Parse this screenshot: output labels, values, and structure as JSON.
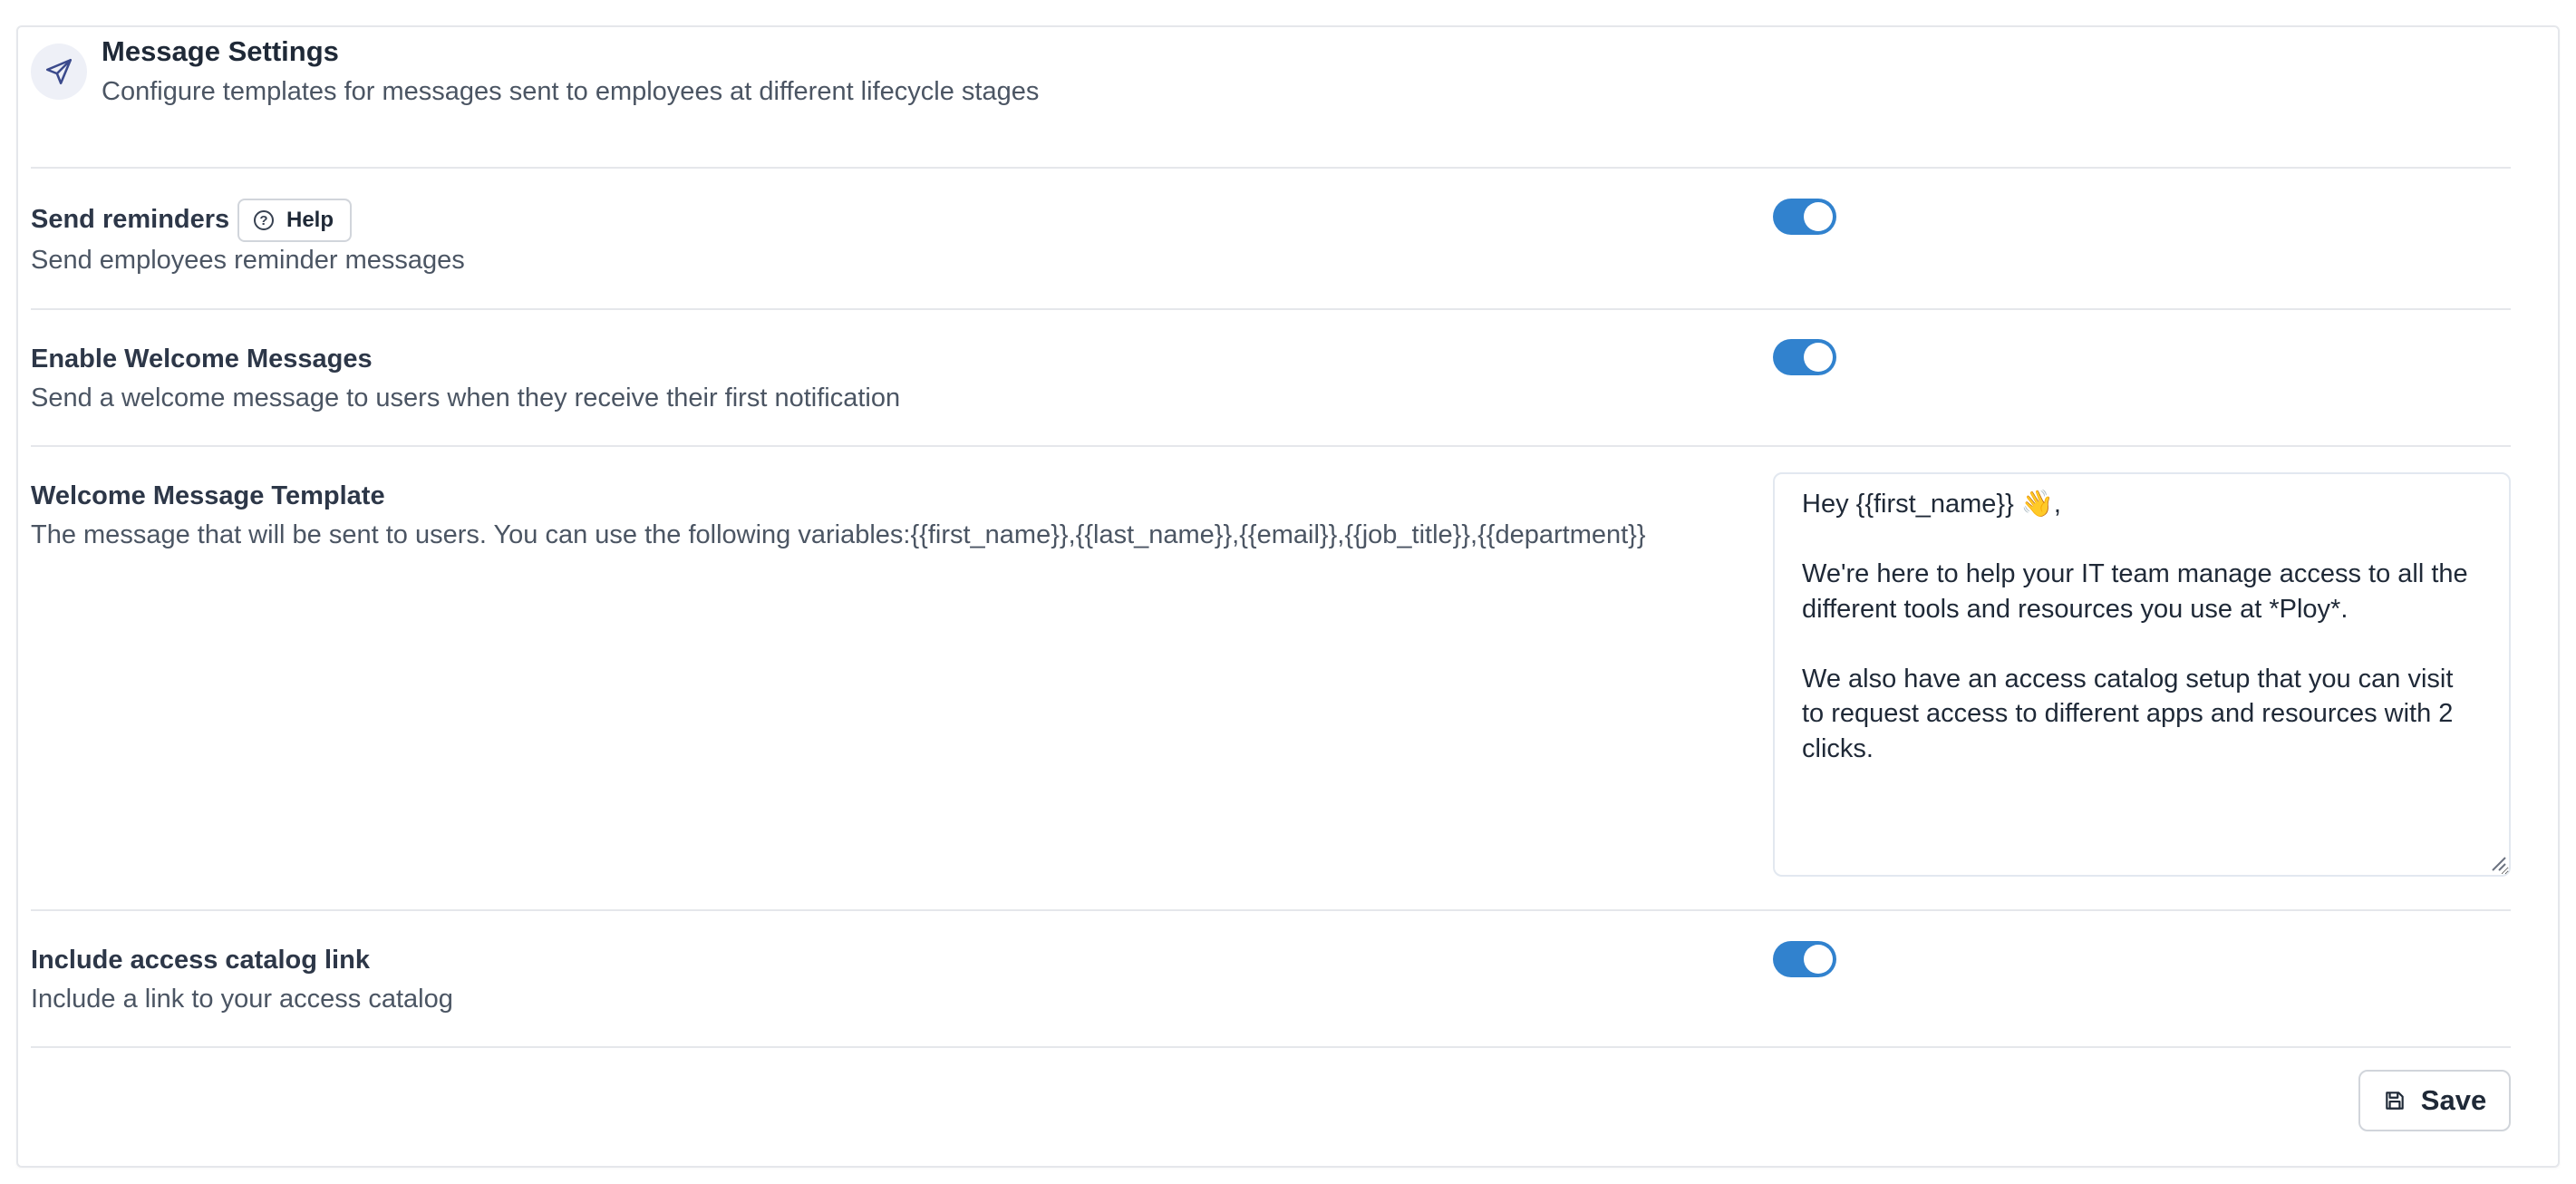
{
  "header": {
    "title": "Message Settings",
    "subtitle": "Configure templates for messages sent to employees at different lifecycle stages",
    "icon": "send-icon"
  },
  "settings": {
    "reminders": {
      "label": "Send reminders",
      "help_label": "Help",
      "description": "Send employees reminder messages",
      "enabled": true
    },
    "welcome": {
      "label": "Enable Welcome Messages",
      "description": "Send a welcome message to users when they receive their first notification",
      "enabled": true
    },
    "template": {
      "label": "Welcome Message Template",
      "description": "The message that will be sent to users. You can use the following variables:{{first_name}},{{last_name}},{{email}},{{job_title}},{{department}}",
      "value": "Hey {{first_name}} 👋,\n\nWe're here to help your IT team manage access to all the different tools and resources you use at *Ploy*.\n\nWe also have an access catalog setup that you can visit to request access to different apps and resources with 2 clicks."
    },
    "catalog_link": {
      "label": "Include access catalog link",
      "description": "Include a link to your access catalog",
      "enabled": true
    }
  },
  "footer": {
    "save_label": "Save",
    "save_icon": "save-icon"
  },
  "colors": {
    "toggle_on": "#3182ce",
    "border": "#e5e7eb",
    "text_primary": "#1f2937",
    "text_secondary": "#4b5563"
  }
}
